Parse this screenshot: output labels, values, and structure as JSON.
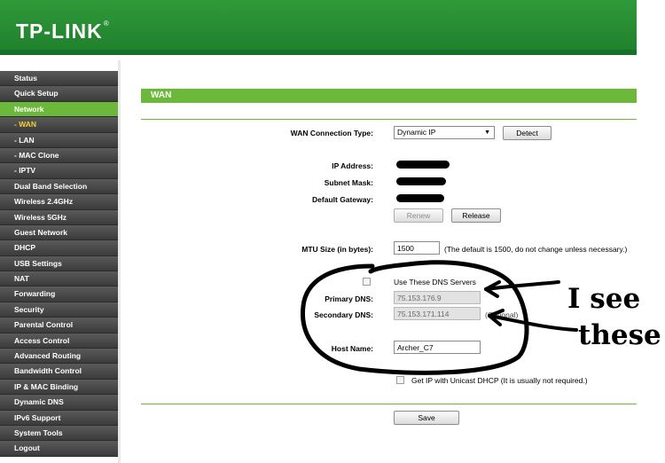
{
  "brand": {
    "logo_text": "TP-LINK",
    "logo_mark": "®"
  },
  "sidebar": {
    "items": [
      {
        "label": "Status",
        "type": "main"
      },
      {
        "label": "Quick Setup",
        "type": "main"
      },
      {
        "label": "Network",
        "type": "active"
      },
      {
        "label": "- WAN",
        "type": "sub-selected"
      },
      {
        "label": "- LAN",
        "type": "sub"
      },
      {
        "label": "- MAC Clone",
        "type": "sub"
      },
      {
        "label": "- IPTV",
        "type": "sub"
      },
      {
        "label": "Dual Band Selection",
        "type": "main"
      },
      {
        "label": "Wireless 2.4GHz",
        "type": "main"
      },
      {
        "label": "Wireless 5GHz",
        "type": "main"
      },
      {
        "label": "Guest Network",
        "type": "main"
      },
      {
        "label": "DHCP",
        "type": "main"
      },
      {
        "label": "USB Settings",
        "type": "main"
      },
      {
        "label": "NAT",
        "type": "main"
      },
      {
        "label": "Forwarding",
        "type": "main"
      },
      {
        "label": "Security",
        "type": "main"
      },
      {
        "label": "Parental Control",
        "type": "main"
      },
      {
        "label": "Access Control",
        "type": "main"
      },
      {
        "label": "Advanced Routing",
        "type": "main"
      },
      {
        "label": "Bandwidth Control",
        "type": "main"
      },
      {
        "label": "IP & MAC Binding",
        "type": "main"
      },
      {
        "label": "Dynamic DNS",
        "type": "main"
      },
      {
        "label": "IPv6 Support",
        "type": "main"
      },
      {
        "label": "System Tools",
        "type": "main"
      },
      {
        "label": "Logout",
        "type": "main"
      }
    ]
  },
  "wan": {
    "section_title": "WAN",
    "connection_type_label": "WAN Connection Type:",
    "connection_type_value": "Dynamic IP",
    "detect_label": "Detect",
    "ip_label": "IP Address:",
    "mask_label": "Subnet Mask:",
    "gateway_label": "Default Gateway:",
    "renew_label": "Renew",
    "release_label": "Release",
    "mtu_label": "MTU Size (in bytes):",
    "mtu_value": "1500",
    "mtu_hint": "(The default is 1500, do not change unless necessary.)",
    "use_dns_label": "Use These DNS Servers",
    "primary_dns_label": "Primary DNS:",
    "primary_dns_value": "75.153.176.9",
    "secondary_dns_label": "Secondary DNS:",
    "secondary_dns_value": "75.153.171.114",
    "optional_text": "(Optional)",
    "host_name_label": "Host Name:",
    "host_name_value": "Archer_C7",
    "unicast_label": "Get IP with Unicast DHCP (It is usually not required.)",
    "save_label": "Save"
  },
  "annotation": {
    "line1": "I see",
    "line2": "these"
  },
  "colors": {
    "brand_green": "#2f9a3a",
    "accent_green": "#6cb83a",
    "sidebar_dark": "#3d3d3d",
    "sub_selected": "#f2d230"
  }
}
